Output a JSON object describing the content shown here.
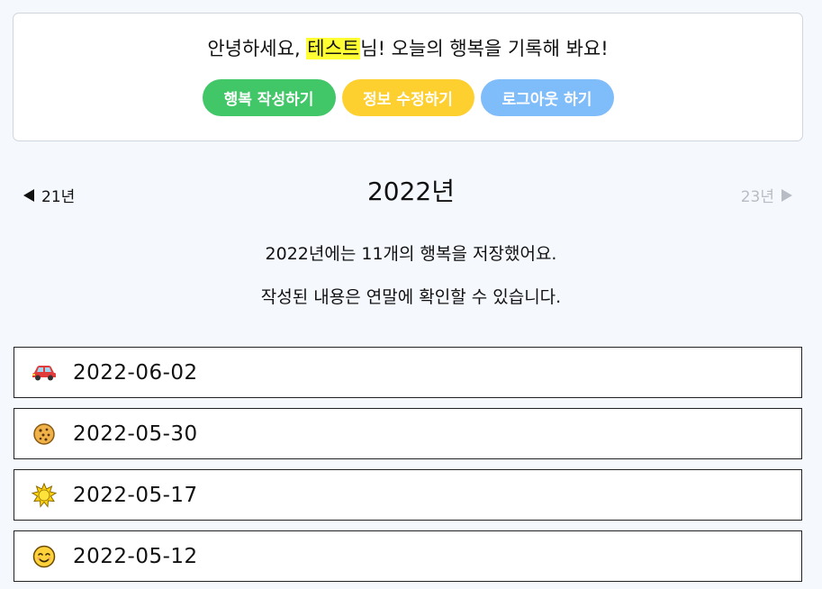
{
  "header": {
    "greeting_before": "안녕하세요, ",
    "user_name": "테스트",
    "greeting_after": "님! 오늘의 행복을 기록해 봐요!",
    "buttons": {
      "write": "행복 작성하기",
      "edit": "정보 수정하기",
      "logout": "로그아웃 하기"
    }
  },
  "year_nav": {
    "prev_label": "21년",
    "current_year": "2022년",
    "next_label": "23년"
  },
  "summary": "2022년에는 11개의 행복을 저장했어요.",
  "notice": "작성된 내용은 연말에 확인할 수 있습니다.",
  "entries": [
    {
      "date": "2022-06-02",
      "icon": "car-icon"
    },
    {
      "date": "2022-05-30",
      "icon": "cookie-icon"
    },
    {
      "date": "2022-05-17",
      "icon": "sun-icon"
    },
    {
      "date": "2022-05-12",
      "icon": "smiling-face-icon"
    }
  ],
  "colors": {
    "write_button": "#41c668",
    "edit_button": "#fdd030",
    "logout_button": "#7fbcfa",
    "name_highlight": "#ffff33",
    "disabled_text": "#b8bcc4"
  }
}
